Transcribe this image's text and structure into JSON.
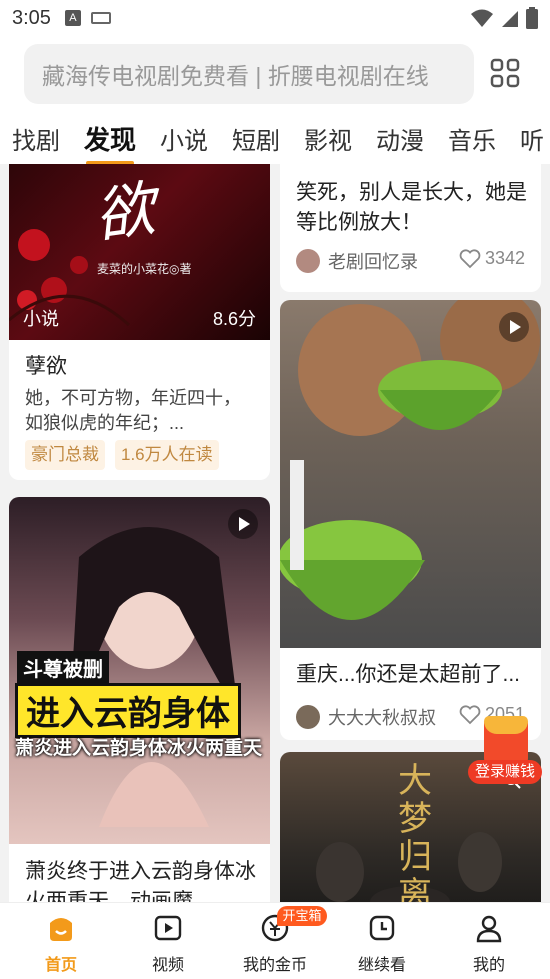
{
  "status_bar": {
    "time": "3:05"
  },
  "search": {
    "placeholder": "藏海传电视剧免费看 | 折腰电视剧在线"
  },
  "tabs": [
    {
      "label": "找剧"
    },
    {
      "label": "发现",
      "active": true
    },
    {
      "label": "小说"
    },
    {
      "label": "短剧"
    },
    {
      "label": "影视"
    },
    {
      "label": "动漫"
    },
    {
      "label": "音乐"
    },
    {
      "label": "听"
    }
  ],
  "feed": {
    "novel_card": {
      "cover_text": "欲",
      "cover_author": "麦菜的小菜花◎著",
      "category": "小说",
      "score": "8.6分",
      "title": "孽欲",
      "desc": "她，不可方物，年近四十，如狼似虎的年纪；...",
      "tags": [
        "豪门总裁",
        "1.6万人在读"
      ]
    },
    "anime_card": {
      "overlay_tag": "斗尊被删",
      "overlay_main": "进入云韵身体",
      "overlay_sub": "萧炎进入云韵身体冰火两重天",
      "title": "萧炎终于进入云韵身体冰火两重天，动画魔"
    },
    "top_right_card": {
      "title": "笑死，别人是长大，她是等比例放大！",
      "author": "老剧回忆录",
      "likes": "3342"
    },
    "food_card": {
      "title": "重庆...你还是太超前了...",
      "author": "大大大秋叔叔",
      "likes": "2051"
    },
    "drama_card": {
      "cover_text": "大梦归离"
    }
  },
  "fab": {
    "label": "登录赚钱"
  },
  "bottom_nav": {
    "items": [
      {
        "label": "首页",
        "icon": "home-icon",
        "active": true
      },
      {
        "label": "视频",
        "icon": "video-icon"
      },
      {
        "label": "我的金币",
        "icon": "coin-icon",
        "badge": "开宝箱"
      },
      {
        "label": "继续看",
        "icon": "clock-icon"
      },
      {
        "label": "我的",
        "icon": "user-icon"
      }
    ]
  },
  "colors": {
    "accent": "#f39a1a",
    "tag_bg": "#fdf2e4",
    "tag_text": "#c08840",
    "red": "#ee3a24"
  }
}
